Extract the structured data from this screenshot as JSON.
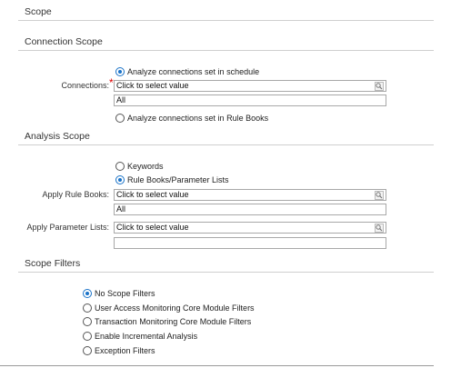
{
  "scope": {
    "title": "Scope"
  },
  "connection_scope": {
    "title": "Connection Scope",
    "connections_label": "Connections:",
    "required_marker": "*",
    "radio_schedule": "Analyze connections set in schedule",
    "select_placeholder": "Click to select value",
    "selected_value": "All",
    "radio_rule_books": "Analyze connections set in Rule Books"
  },
  "analysis_scope": {
    "title": "Analysis Scope",
    "radio_keywords": "Keywords",
    "radio_rule_books_params": "Rule Books/Parameter Lists",
    "apply_rule_books_label": "Apply Rule Books:",
    "rule_books_placeholder": "Click to select value",
    "rule_books_value": "All",
    "apply_param_lists_label": "Apply Parameter Lists:",
    "param_lists_placeholder": "Click to select value",
    "param_lists_value": ""
  },
  "scope_filters": {
    "title": "Scope Filters",
    "options": [
      {
        "label": "No Scope Filters",
        "checked": true
      },
      {
        "label": "User Access Monitoring Core Module Filters",
        "checked": false
      },
      {
        "label": "Transaction Monitoring Core Module Filters",
        "checked": false
      },
      {
        "label": "Enable Incremental Analysis",
        "checked": false
      },
      {
        "label": "Exception Filters",
        "checked": false
      }
    ]
  },
  "colors": {
    "accent": "#1a73c8",
    "required": "#dd0000",
    "rule": "#cfcfcf"
  },
  "icons": {
    "select_button": "search-icon"
  }
}
